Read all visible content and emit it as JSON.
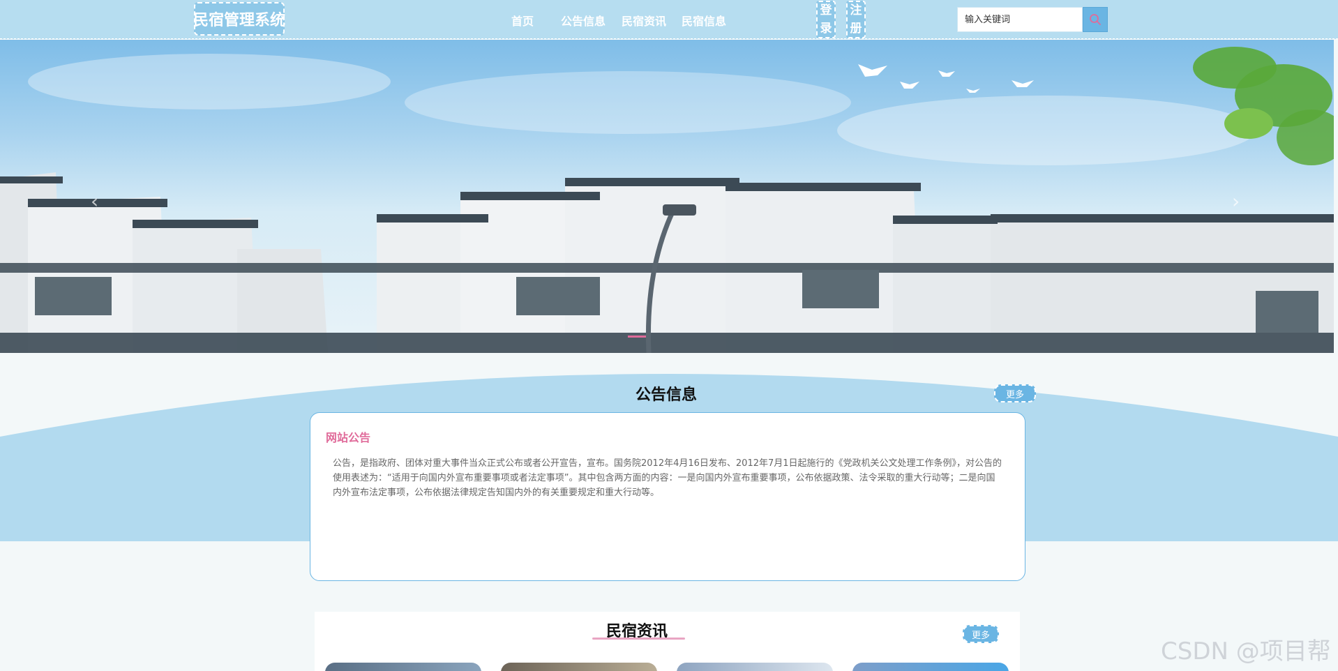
{
  "header": {
    "logo": "民宿管理系统",
    "nav": [
      {
        "label": "首页"
      },
      {
        "label": "公告信息"
      },
      {
        "label": "民宿资讯"
      },
      {
        "label": "民宿信息"
      }
    ],
    "login_label": [
      "登",
      "录"
    ],
    "register_label": [
      "注",
      "册"
    ],
    "search_placeholder": "输入关键词"
  },
  "notice": {
    "title": "公告信息",
    "more": "更多",
    "card_title": "网站公告",
    "card_text": "公告，是指政府、团体对重大事件当众正式公布或者公开宣告，宣布。国务院2012年4月16日发布、2012年7月1日起施行的《党政机关公文处理工作条例》，对公告的使用表述为：“适用于向国内外宣布重要事项或者法定事项”。其中包含两方面的内容：一是向国内外宣布重要事项，公布依据政策、法令采取的重大行动等；二是向国内外宣布法定事项，公布依据法律规定告知国内外的有关重要规定和重大行动等。"
  },
  "news": {
    "title": "民宿资讯",
    "more": "更多"
  },
  "watermark": "CSDN @项目帮",
  "colors": {
    "header": "#b6ddf0",
    "accent": "#6ab5e3",
    "pink": "#e06b9a"
  }
}
